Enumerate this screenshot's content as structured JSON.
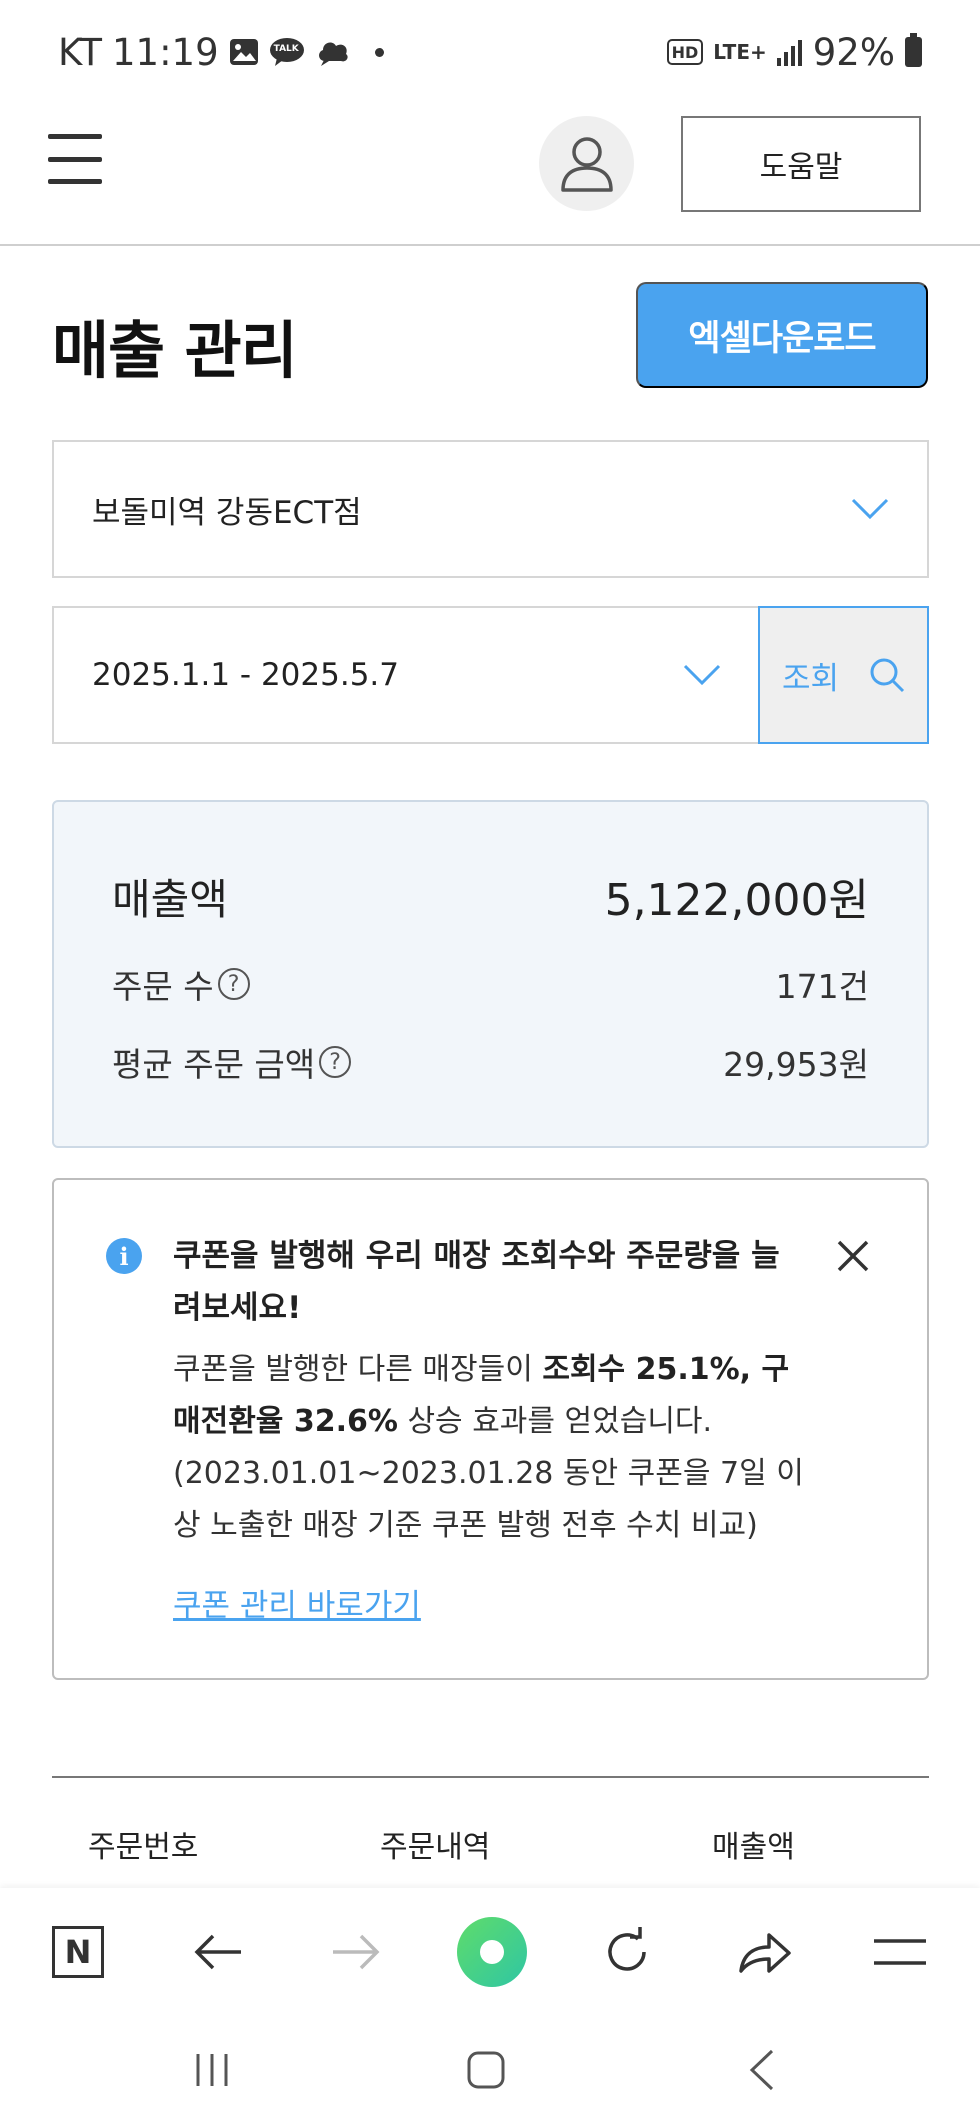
{
  "status_bar": {
    "carrier": "KT",
    "time": "11:19",
    "talk_badge": "TALK",
    "hd_badge": "HD",
    "network": "LTE+",
    "battery": "92%"
  },
  "header": {
    "help_label": "도움말"
  },
  "page": {
    "title": "매출 관리",
    "excel_button": "엑셀다운로드"
  },
  "filters": {
    "store": "보돌미역 강동ECT점",
    "date_range": "2025.1.1 - 2025.5.7",
    "search_label": "조회"
  },
  "summary": {
    "sales_label": "매출액",
    "sales_value": "5,122,000원",
    "orders_label": "주문 수",
    "orders_value": "171건",
    "avg_label": "평균 주문 금액",
    "avg_value": "29,953원",
    "help_glyph": "?"
  },
  "notice": {
    "info_glyph": "i",
    "title": "쿠폰을 발행해 우리 매장 조회수와 주문량을 늘려보세요!",
    "body_pre": "쿠폰을 발행한 다른 매장들이 ",
    "body_bold": "조회수 25.1%, 구매전환율 32.6%",
    "body_post": " 상승 효과를 얻었습니다. (2023.01.01~2023.01.28 동안 쿠폰을 7일 이상 노출한 매장 기준 쿠폰 발행 전후 수치 비교)",
    "link": "쿠폰 관리 바로가기"
  },
  "table": {
    "columns": [
      "주문번호",
      "주문내역",
      "매출액"
    ]
  },
  "browser_bar": {
    "naver_glyph": "N"
  },
  "colors": {
    "accent": "#4aa3ef",
    "summary_bg": "#f2f6fa",
    "green": "#3fd08a"
  }
}
